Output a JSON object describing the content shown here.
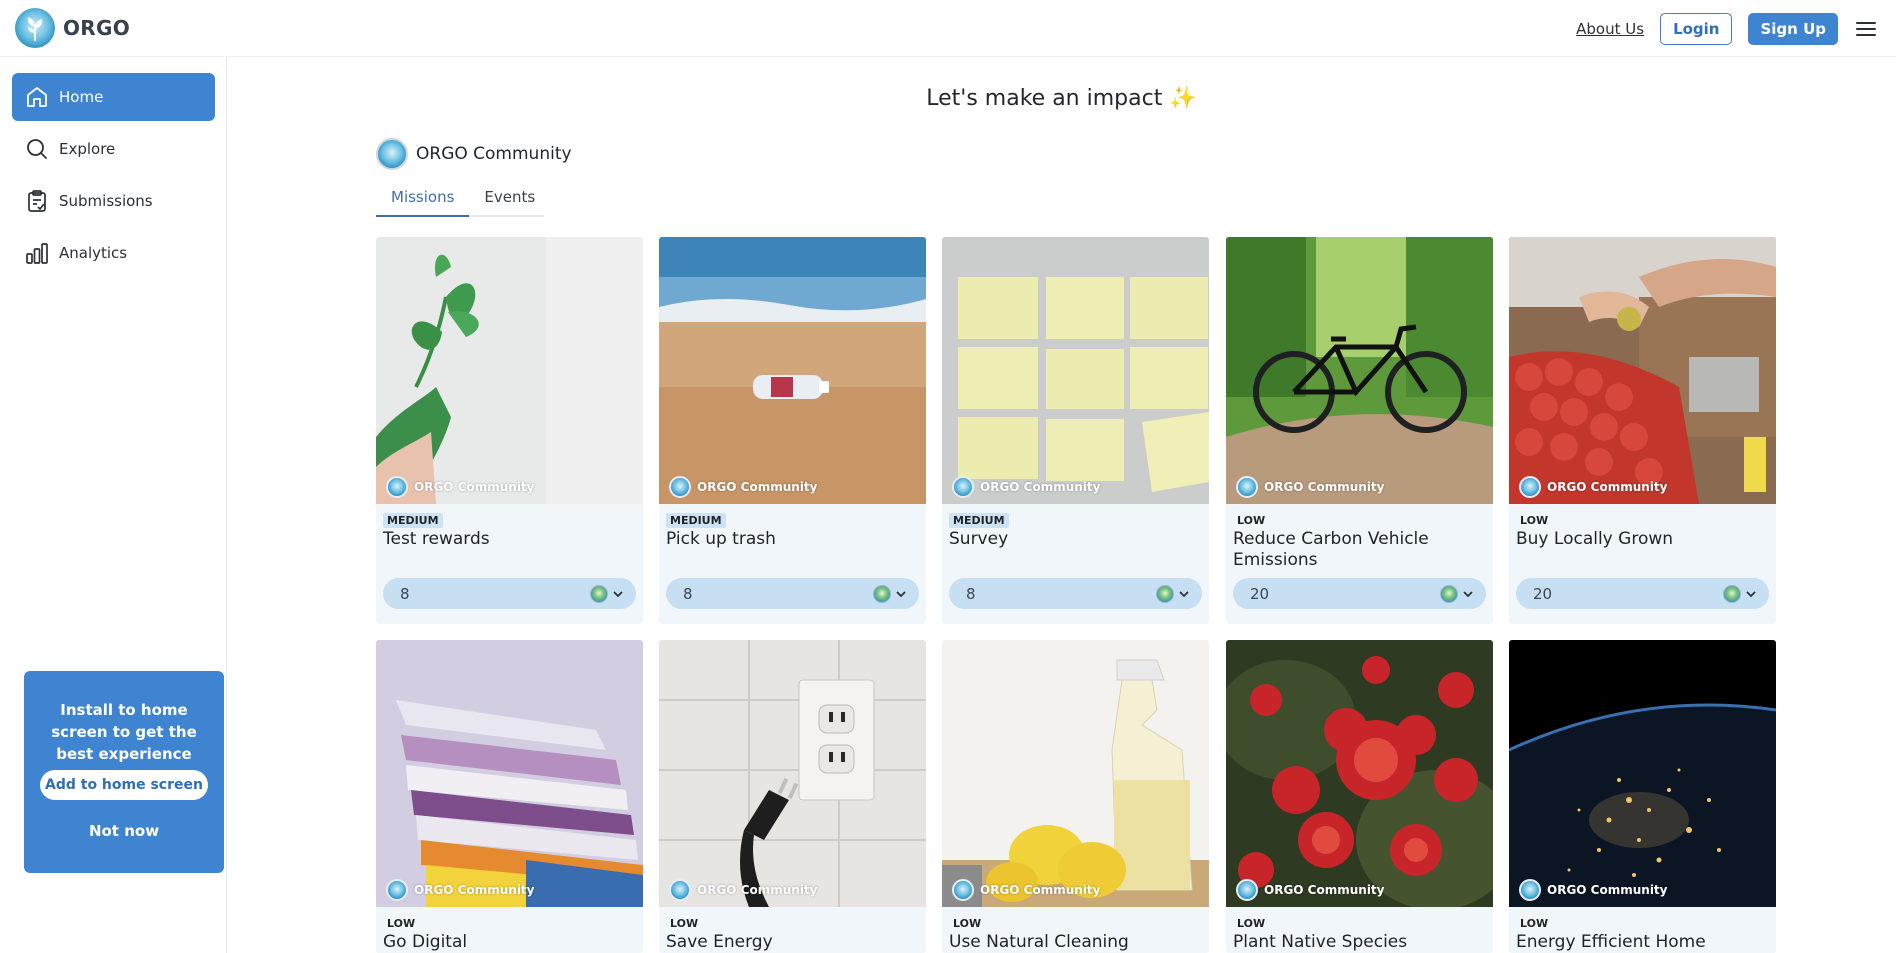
{
  "header": {
    "brand_name": "ORGO",
    "about_label": "About Us",
    "login_label": "Login",
    "signup_label": "Sign Up"
  },
  "sidebar": {
    "items": [
      {
        "label": "Home",
        "icon": "home-icon",
        "active": true
      },
      {
        "label": "Explore",
        "icon": "search-icon",
        "active": false
      },
      {
        "label": "Submissions",
        "icon": "clipboard-icon",
        "active": false
      },
      {
        "label": "Analytics",
        "icon": "bar-chart-icon",
        "active": false
      }
    ]
  },
  "install_prompt": {
    "text": "Install to home screen to get the best experience",
    "add_label": "Add to home screen",
    "dismiss_label": "Not now"
  },
  "main": {
    "title": "Let's make an impact ✨",
    "community_name": "ORGO Community",
    "tabs": [
      {
        "label": "Missions",
        "active": true
      },
      {
        "label": "Events",
        "active": false
      }
    ]
  },
  "missions": [
    {
      "community": "ORGO Community",
      "level": "MEDIUM",
      "title": "Test rewards",
      "reward": "8"
    },
    {
      "community": "ORGO Community",
      "level": "MEDIUM",
      "title": "Pick up trash",
      "reward": "8"
    },
    {
      "community": "ORGO Community",
      "level": "MEDIUM",
      "title": "Survey",
      "reward": "8"
    },
    {
      "community": "ORGO Community",
      "level": "LOW",
      "title": "Reduce Carbon Vehicle Emissions",
      "reward": "20"
    },
    {
      "community": "ORGO Community",
      "level": "LOW",
      "title": "Buy Locally Grown",
      "reward": "20"
    },
    {
      "community": "ORGO Community",
      "level": "LOW",
      "title": "Go Digital"
    },
    {
      "community": "ORGO Community",
      "level": "LOW",
      "title": "Save Energy"
    },
    {
      "community": "ORGO Community",
      "level": "LOW",
      "title": "Use Natural Cleaning Products"
    },
    {
      "community": "ORGO Community",
      "level": "LOW",
      "title": "Plant Native Species"
    },
    {
      "community": "ORGO Community",
      "level": "LOW",
      "title": "Energy Efficient Home"
    }
  ],
  "colors": {
    "accent": "#3f84d0",
    "medium_badge": "#cde3f5",
    "reward_pill": "#c6dff3",
    "card_bg": "#f1f6fb"
  }
}
